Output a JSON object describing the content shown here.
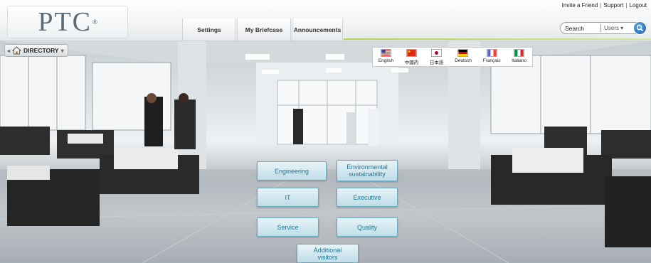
{
  "header": {
    "logo": "PTC",
    "logo_mark": "®",
    "top_links": [
      "Invite a Friend",
      "Support",
      "Logout"
    ],
    "separator": "|",
    "nav": [
      "Settings",
      "My Briefcase",
      "Announcements"
    ],
    "search": {
      "label": "Search",
      "filter": "Users",
      "filter_arrow": "▾"
    }
  },
  "toolbar": {
    "back_arrow": "◂",
    "directory_label": "DIRECTORY",
    "directory_arrow": "▾"
  },
  "languages": [
    {
      "label": "English",
      "flag": "us-flag-icon"
    },
    {
      "label": "中國的",
      "flag": "china-flag-icon"
    },
    {
      "label": "日本語",
      "flag": "japan-flag-icon"
    },
    {
      "label": "Deutsch",
      "flag": "germany-flag-icon"
    },
    {
      "label": "Français",
      "flag": "france-flag-icon"
    },
    {
      "label": "Italiano",
      "flag": "italy-flag-icon"
    }
  ],
  "departments": [
    "Engineering",
    "Environmental sustainability",
    "IT",
    "Executive",
    "Service",
    "Quality",
    "Additional visitors"
  ],
  "colors": {
    "button_text": "#1e7896",
    "button_border": "#6ea9bf",
    "accent_green": "#b8cf5a",
    "search_blue": "#1f5fa8"
  }
}
